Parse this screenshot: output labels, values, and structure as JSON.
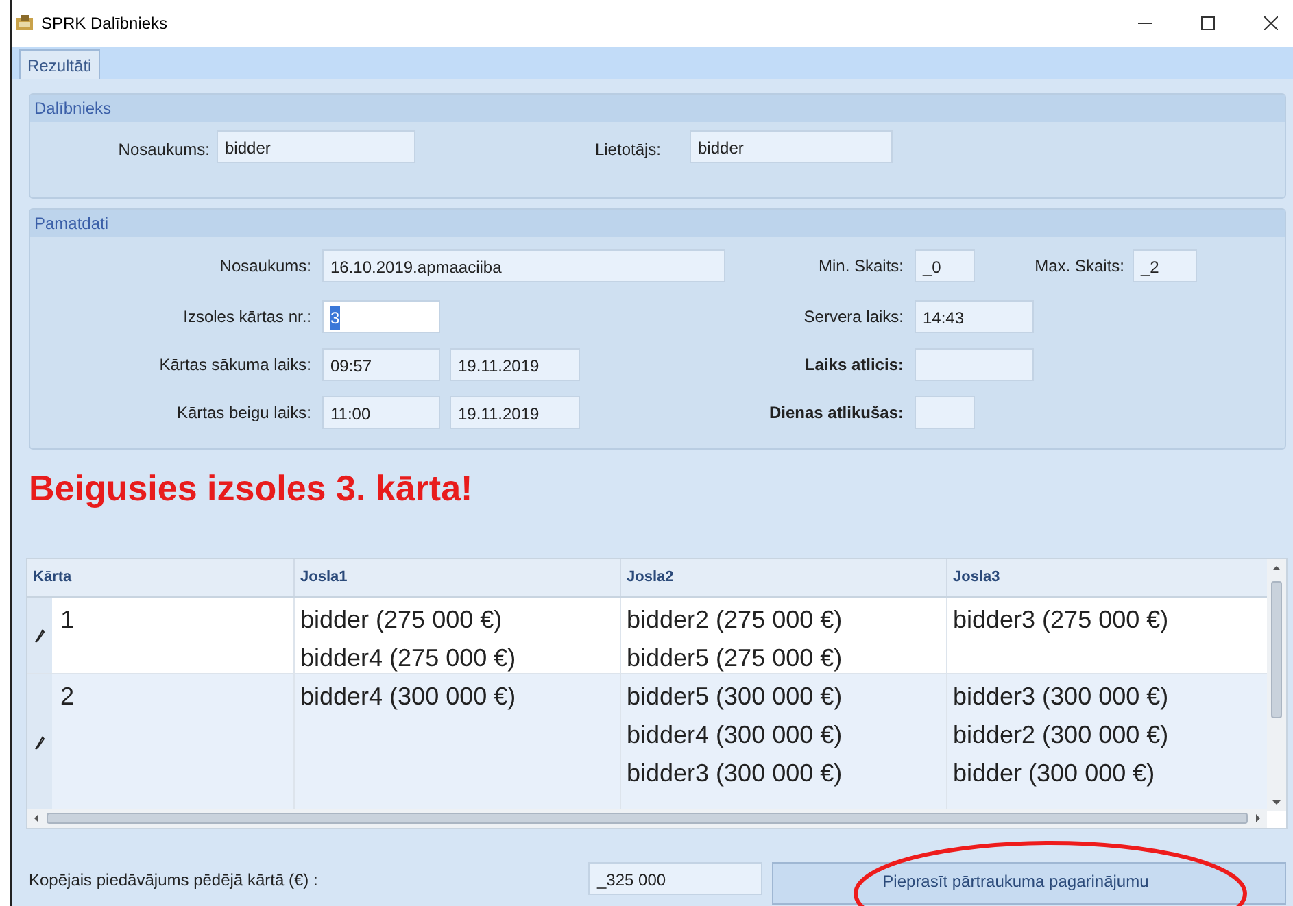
{
  "window": {
    "title": "SPRK Dalībnieks"
  },
  "tabs": [
    {
      "label": "Rezultāti",
      "selected": true
    }
  ],
  "participant": {
    "title": "Dalībnieks",
    "fields": [
      {
        "label": "Nosaukums:",
        "value": "bidder"
      },
      {
        "label": "Lietotājs:",
        "value": "bidder"
      }
    ]
  },
  "basics": {
    "title": "Pamatdati",
    "name": {
      "label": "Nosaukums:",
      "value": "16.10.2019.apmaaciiba"
    },
    "min_count": {
      "label": "Min. Skaits:",
      "value": "_0"
    },
    "max_count": {
      "label": "Max. Skaits:",
      "value": "_2"
    },
    "round_number": {
      "label": "Izsoles kārtas nr.:",
      "value": "3",
      "text_selected": true
    },
    "server_time": {
      "label": "Servera laiks:",
      "value": "14:43"
    },
    "round_start": {
      "label": "Kārtas sākuma laiks:",
      "time": "09:57",
      "date": "19.11.2019"
    },
    "time_left": {
      "label": "Laiks atlicis:"
    },
    "round_end": {
      "label": "Kārtas beigu laiks:",
      "time": "11:00",
      "date": "19.11.2019"
    },
    "days_left": {
      "label": "Dienas atlikušas:"
    }
  },
  "status_message": "Beigusies izsoles 3. kārta!",
  "table": {
    "columns": [
      "Kārta",
      "Josla1",
      "Josla2",
      "Josla3"
    ],
    "rows": [
      {
        "round": "1",
        "lanes": [
          [
            "bidder (275 000 €)",
            "bidder4 (275 000 €)"
          ],
          [
            "bidder2 (275 000 €)",
            "bidder5 (275 000 €)"
          ],
          [
            "bidder3 (275 000 €)"
          ]
        ]
      },
      {
        "round": "2",
        "lanes": [
          [
            "bidder4 (300 000 €)"
          ],
          [
            "bidder5 (300 000 €)",
            "bidder4 (300 000 €)",
            "bidder3 (300 000 €)"
          ],
          [
            "bidder3 (300 000 €)",
            "bidder2 (300 000 €)",
            "bidder (300 000 €)"
          ]
        ]
      }
    ]
  },
  "footer": {
    "label": "Kopējais piedāvājums pēdējā kārtā (€) :",
    "value": "_325 000",
    "button": "Pieprasīt pārtraukuma pagarinājumu"
  },
  "annotation": {
    "kind": "ellipse"
  }
}
